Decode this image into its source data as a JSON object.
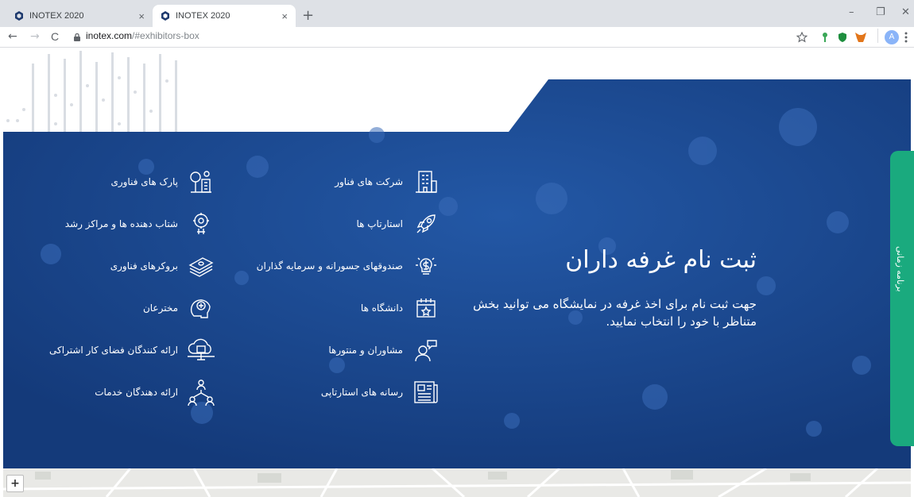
{
  "browser": {
    "tabs": [
      {
        "title": "INOTEX 2020",
        "close": "×"
      },
      {
        "title": "INOTEX 2020",
        "close": "×"
      }
    ],
    "new_tab": "+",
    "window_controls": {
      "minimize": "–",
      "restore": "❐",
      "close": "✕"
    },
    "nav": {
      "back": "←",
      "forward": "→",
      "reload": "C"
    },
    "url": {
      "host": "inotex.com",
      "path": "/#exhibitors-box"
    },
    "profile_initial": "A"
  },
  "page": {
    "title": "ثبت نام غرفه داران",
    "description": "جهت ثبت نام برای اخذ غرفه در نمایشگاه می توانید بخش متناظر با خود را انتخاب نمایید.",
    "side_tab_label": "برنامه زمانی",
    "map_zoom_in": "+",
    "colors": {
      "hero": "#1b4488",
      "side_tab": "#1aaa7e"
    },
    "middle_column": [
      {
        "label": "شرکت های فناور",
        "icon": "building-icon"
      },
      {
        "label": "استارتاپ ها",
        "icon": "rocket-icon"
      },
      {
        "label": "صندوقهای جسورانه و سرمایه گذاران",
        "icon": "idea-money-icon"
      },
      {
        "label": "دانشگاه ها",
        "icon": "calendar-star-icon"
      },
      {
        "label": "مشاوران و منتورها",
        "icon": "consultant-icon"
      },
      {
        "label": "رسانه های استارتاپی",
        "icon": "newspaper-icon"
      }
    ],
    "left_column": [
      {
        "label": "پارک های فناوری",
        "icon": "park-icon"
      },
      {
        "label": "شتاب دهنده ها و مراکز رشد",
        "icon": "accelerator-icon"
      },
      {
        "label": "بروکرهای فناوری",
        "icon": "money-stack-icon"
      },
      {
        "label": "مخترعان",
        "icon": "inventor-icon"
      },
      {
        "label": "ارائه کنندگان فضای کار اشتراکی",
        "icon": "cloud-cowork-icon"
      },
      {
        "label": "ارائه دهندگان خدمات",
        "icon": "network-people-icon"
      }
    ]
  }
}
